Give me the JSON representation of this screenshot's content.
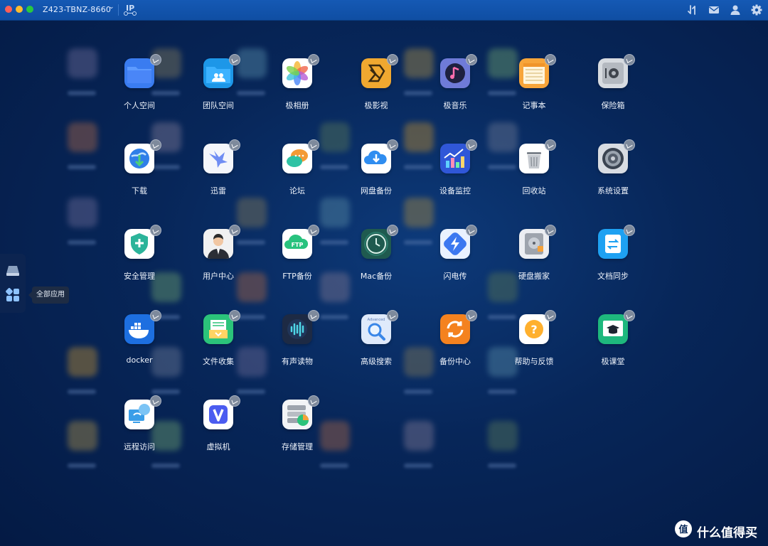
{
  "titlebar": {
    "device_name": "Z423-TBNZ-8660",
    "ip_icon": "IP",
    "right_icons": [
      "transfer-icon",
      "mail-icon",
      "user-icon",
      "settings-icon"
    ]
  },
  "dock": {
    "items": [
      {
        "name": "storage-drive-icon"
      },
      {
        "name": "all-apps-icon"
      }
    ],
    "tooltip": "全部应用"
  },
  "apps": [
    {
      "label": "个人空间",
      "icon": "folder-icon"
    },
    {
      "label": "团队空间",
      "icon": "team-folder-icon"
    },
    {
      "label": "极相册",
      "icon": "photos-icon"
    },
    {
      "label": "极影视",
      "icon": "video-icon"
    },
    {
      "label": "极音乐",
      "icon": "music-icon"
    },
    {
      "label": "记事本",
      "icon": "notepad-icon"
    },
    {
      "label": "保险箱",
      "icon": "safe-icon"
    },
    {
      "label": "下载",
      "icon": "download-icon"
    },
    {
      "label": "迅雷",
      "icon": "thunder-icon"
    },
    {
      "label": "论坛",
      "icon": "forum-icon"
    },
    {
      "label": "网盘备份",
      "icon": "cloud-backup-icon"
    },
    {
      "label": "设备监控",
      "icon": "monitor-chart-icon"
    },
    {
      "label": "回收站",
      "icon": "trash-icon"
    },
    {
      "label": "系统设置",
      "icon": "system-settings-icon"
    },
    {
      "label": "安全管理",
      "icon": "shield-icon"
    },
    {
      "label": "用户中心",
      "icon": "user-center-icon"
    },
    {
      "label": "FTP备份",
      "icon": "ftp-icon"
    },
    {
      "label": "Mac备份",
      "icon": "time-machine-icon"
    },
    {
      "label": "闪电传",
      "icon": "flash-transfer-icon"
    },
    {
      "label": "硬盘搬家",
      "icon": "disk-move-icon"
    },
    {
      "label": "文档同步",
      "icon": "doc-sync-icon"
    },
    {
      "label": "docker",
      "icon": "docker-icon"
    },
    {
      "label": "文件收集",
      "icon": "file-collect-icon"
    },
    {
      "label": "有声读物",
      "icon": "audiobook-icon"
    },
    {
      "label": "高级搜索",
      "icon": "advanced-search-icon",
      "icon_text": "Advanced"
    },
    {
      "label": "备份中心",
      "icon": "backup-center-icon"
    },
    {
      "label": "帮助与反馈",
      "icon": "help-icon"
    },
    {
      "label": "极课堂",
      "icon": "classroom-icon"
    },
    {
      "label": "远程访问",
      "icon": "remote-access-icon"
    },
    {
      "label": "虚拟机",
      "icon": "virtual-machine-icon"
    },
    {
      "label": "存储管理",
      "icon": "storage-manage-icon"
    }
  ],
  "watermark": {
    "icon_text": "值",
    "text": "什么值得买"
  },
  "colors": {
    "background": "#072659",
    "titlebar": "#1559b4"
  }
}
